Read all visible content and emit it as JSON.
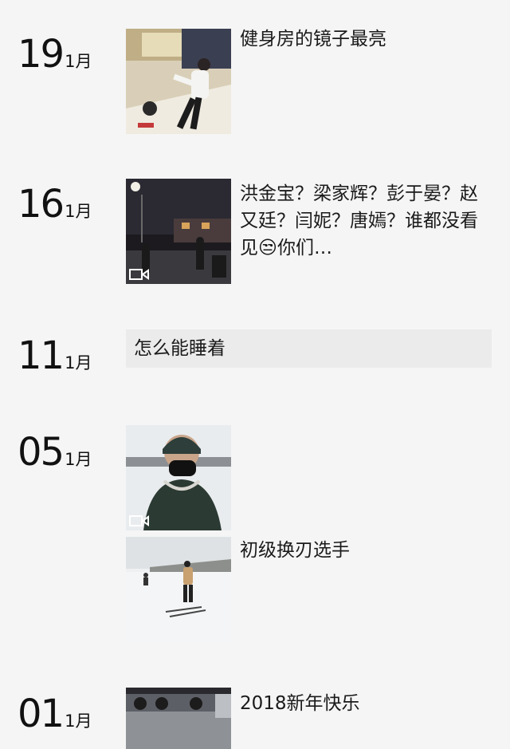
{
  "entries": [
    {
      "day": "19",
      "month": "1月",
      "caption": "健身房的镜子最亮",
      "media": "gym-mirror-selfie"
    },
    {
      "day": "16",
      "month": "1月",
      "caption": "洪金宝？梁家辉？彭于晏？赵又廷？闫妮？唐嫣？谁都没看见😒你们…",
      "media": "night-street-video"
    },
    {
      "day": "11",
      "month": "1月",
      "text": "怎么能睡着"
    },
    {
      "day": "05",
      "month": "1月",
      "caption": "初级换刃选手",
      "media": [
        "masked-skier-video",
        "skier-on-slope"
      ]
    },
    {
      "day": "01",
      "month": "1月",
      "caption": "2018新年快乐",
      "media": "stage-lights"
    }
  ],
  "colors": {
    "background": "#f5f5f5",
    "text_post_bg": "#ebebeb",
    "text": "#111111"
  }
}
